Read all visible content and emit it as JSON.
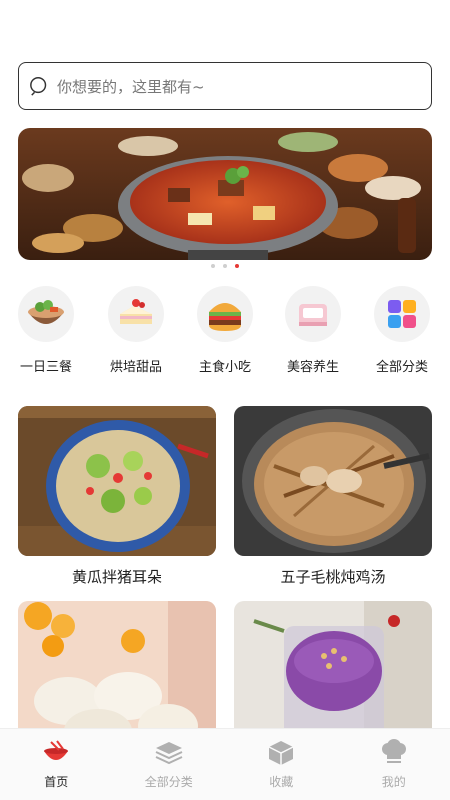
{
  "search": {
    "placeholder": "你想要的，这里都有~"
  },
  "banner": {
    "dots": 3,
    "active_dot": 3
  },
  "categories": [
    {
      "label": "一日三餐",
      "icon": "bowl-icon"
    },
    {
      "label": "烘培甜品",
      "icon": "cake-icon"
    },
    {
      "label": "主食小吃",
      "icon": "burger-icon"
    },
    {
      "label": "美容养生",
      "icon": "cosmetics-icon"
    },
    {
      "label": "全部分类",
      "icon": "grid-blocks-icon"
    }
  ],
  "recipes": [
    {
      "title": "黄瓜拌猪耳朵"
    },
    {
      "title": "五子毛桃炖鸡汤"
    },
    {
      "title": ""
    },
    {
      "title": ""
    }
  ],
  "tabbar": {
    "items": [
      {
        "label": "首页",
        "icon": "home-bowl-icon",
        "active": true
      },
      {
        "label": "全部分类",
        "icon": "layers-icon",
        "active": false
      },
      {
        "label": "收藏",
        "icon": "box-icon",
        "active": false
      },
      {
        "label": "我的",
        "icon": "chef-hat-icon",
        "active": false
      }
    ]
  },
  "colors": {
    "accent": "#e53935",
    "inactive": "#aaaaaa"
  }
}
